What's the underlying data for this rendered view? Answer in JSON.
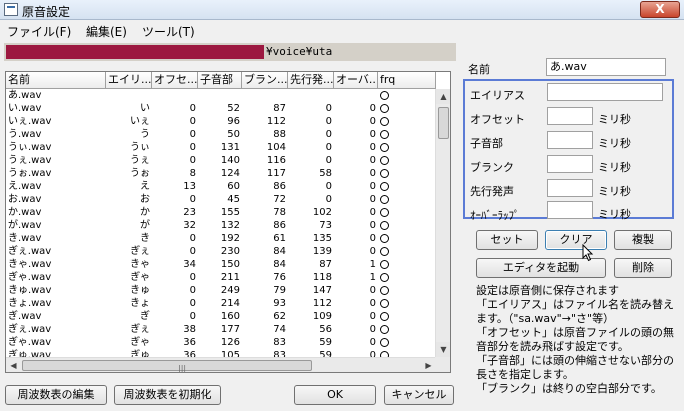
{
  "window": {
    "title": "原音設定",
    "close_glyph": "X"
  },
  "menu": [
    "ファイル(F)",
    "編集(E)",
    "ツール(T)"
  ],
  "path": "¥voice¥uta",
  "table": {
    "columns": [
      "名前",
      "エイリ...",
      "オフセ...",
      "子音部",
      "ブラン...",
      "先行発...",
      "オーバ...",
      "frq"
    ],
    "rows": [
      [
        "あ.wav",
        "",
        "",
        "",
        "",
        "",
        "",
        "○"
      ],
      [
        "い.wav",
        "い",
        "0",
        "52",
        "87",
        "0",
        "0",
        "○"
      ],
      [
        "いぇ.wav",
        "いぇ",
        "0",
        "96",
        "112",
        "0",
        "0",
        "○"
      ],
      [
        "う.wav",
        "う",
        "0",
        "50",
        "88",
        "0",
        "0",
        "○"
      ],
      [
        "うぃ.wav",
        "うぃ",
        "0",
        "131",
        "104",
        "0",
        "0",
        "○"
      ],
      [
        "うぇ.wav",
        "うぇ",
        "0",
        "140",
        "116",
        "0",
        "0",
        "○"
      ],
      [
        "うぉ.wav",
        "うぉ",
        "8",
        "124",
        "117",
        "58",
        "0",
        "○"
      ],
      [
        "え.wav",
        "え",
        "13",
        "60",
        "86",
        "0",
        "0",
        "○"
      ],
      [
        "お.wav",
        "お",
        "0",
        "45",
        "72",
        "0",
        "0",
        "○"
      ],
      [
        "か.wav",
        "か",
        "23",
        "155",
        "78",
        "102",
        "0",
        "○"
      ],
      [
        "が.wav",
        "が",
        "32",
        "132",
        "86",
        "73",
        "0",
        "○"
      ],
      [
        "き.wav",
        "き",
        "0",
        "192",
        "61",
        "135",
        "0",
        "○"
      ],
      [
        "ぎぇ.wav",
        "ぎぇ",
        "0",
        "230",
        "84",
        "139",
        "0",
        "○"
      ],
      [
        "きゃ.wav",
        "きゃ",
        "34",
        "150",
        "84",
        "87",
        "1",
        "○"
      ],
      [
        "ぎゃ.wav",
        "ぎゃ",
        "0",
        "211",
        "76",
        "118",
        "1",
        "○"
      ],
      [
        "きゅ.wav",
        "きゅ",
        "0",
        "249",
        "79",
        "147",
        "0",
        "○"
      ],
      [
        "きょ.wav",
        "きょ",
        "0",
        "214",
        "93",
        "112",
        "0",
        "○"
      ],
      [
        "ぎ.wav",
        "ぎ",
        "0",
        "160",
        "62",
        "109",
        "0",
        "○"
      ],
      [
        "ぎぇ.wav",
        "ぎぇ",
        "38",
        "177",
        "74",
        "56",
        "0",
        "○"
      ],
      [
        "ぎゃ.wav",
        "ぎゃ",
        "36",
        "126",
        "83",
        "59",
        "0",
        "○"
      ],
      [
        "ぎゅ.wav",
        "ぎゅ",
        "36",
        "105",
        "83",
        "59",
        "0",
        "○"
      ]
    ]
  },
  "bottom_buttons": {
    "edit_freq": "周波数表の編集",
    "reset_freq": "周波数表を初期化",
    "ok": "OK",
    "cancel": "キャンセル"
  },
  "detail": {
    "name_label": "名前",
    "name_value": "あ.wav",
    "fields": {
      "alias": "エイリアス",
      "offset": "オフセット",
      "consonant": "子音部",
      "blank": "ブランク",
      "preutterance": "先行発声",
      "overlap": "ｵｰﾊﾞｰﾗｯﾌﾟ"
    },
    "unit": "ミリ秒"
  },
  "action_buttons": {
    "set": "セット",
    "clear": "クリア",
    "duplicate": "複製",
    "launch_editor": "エディタを起動",
    "delete": "削除"
  },
  "help_lines": [
    "設定は原音側に保存されます",
    "「エイリアス」はファイル名を読み替えます。（\"sa.wav\"→\"さ\"等）",
    "「オフセット」は原音ファイルの頭の無音部分を読み飛ばす設定です。",
    "「子音部」には頭の伸縮させない部分の長さを指定します。",
    "「ブランク」は終りの空白部分です。"
  ],
  "accent_color": "#5b7bd5"
}
